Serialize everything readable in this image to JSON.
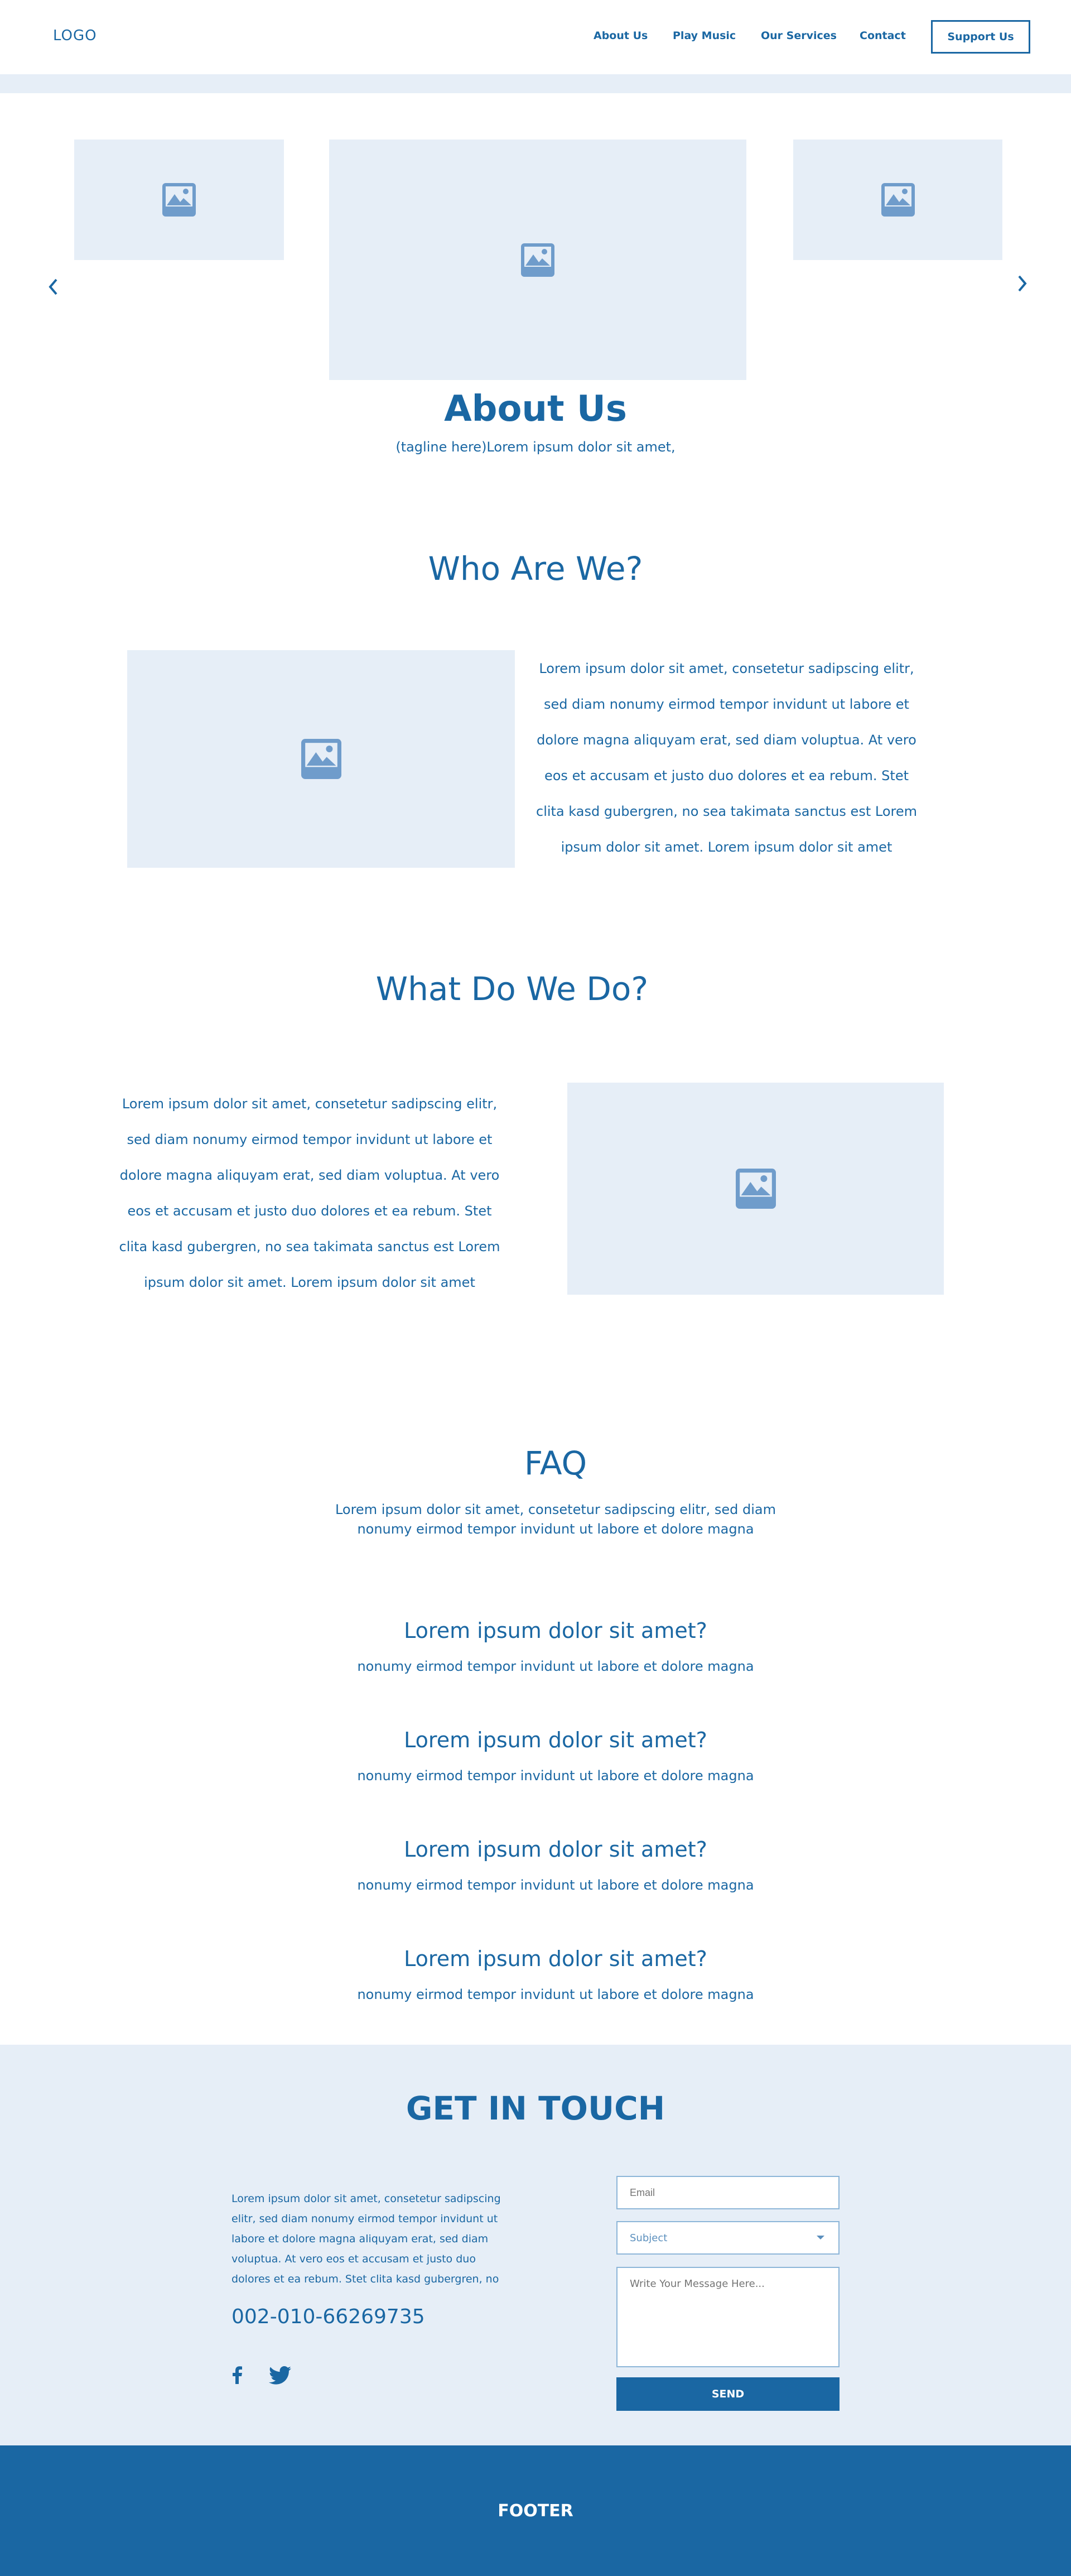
{
  "header": {
    "logo": "LOGO",
    "nav": [
      "About Us",
      "Play Music",
      "Our Services",
      "Contact"
    ],
    "cta": "Support Us"
  },
  "hero": {
    "title": "About Us",
    "tagline": "(tagline here)Lorem ipsum dolor sit amet,"
  },
  "who": {
    "title": "Who Are We?",
    "lines": [
      "Lorem ipsum dolor sit amet, consetetur sadipscing elitr,",
      "sed diam nonumy eirmod tempor invidunt ut labore et",
      "dolore magna aliquyam erat, sed diam voluptua. At vero",
      "eos et accusam et justo duo dolores et ea rebum. Stet",
      "clita kasd gubergren, no sea takimata sanctus est Lorem",
      "ipsum dolor sit amet. Lorem ipsum dolor sit amet"
    ]
  },
  "what": {
    "title": "What Do We Do?",
    "lines": [
      "Lorem ipsum dolor sit amet, consetetur sadipscing elitr,",
      "sed diam nonumy eirmod tempor invidunt ut labore et",
      "dolore magna aliquyam erat, sed diam voluptua. At vero",
      "eos et accusam et justo duo dolores et ea rebum. Stet",
      "clita kasd gubergren, no sea takimata sanctus est Lorem",
      "ipsum dolor sit amet. Lorem ipsum dolor sit amet"
    ]
  },
  "faq": {
    "title": "FAQ",
    "intro": [
      "Lorem ipsum dolor sit amet, consetetur sadipscing elitr, sed diam",
      "nonumy eirmod tempor invidunt ut labore et dolore magna"
    ],
    "items": [
      {
        "q": "Lorem ipsum dolor sit amet?",
        "a": "nonumy eirmod tempor invidunt ut labore et dolore magna"
      },
      {
        "q": "Lorem ipsum dolor sit amet?",
        "a": "nonumy eirmod tempor invidunt ut labore et dolore magna"
      },
      {
        "q": "Lorem ipsum dolor sit amet?",
        "a": "nonumy eirmod tempor invidunt ut labore et dolore magna"
      },
      {
        "q": "Lorem ipsum dolor sit amet?",
        "a": "nonumy eirmod tempor invidunt ut labore et dolore magna"
      }
    ]
  },
  "contact": {
    "title": "GET IN TOUCH",
    "lines": [
      "Lorem ipsum dolor sit amet, consetetur sadipscing",
      "elitr, sed diam nonumy eirmod tempor invidunt ut",
      "labore et dolore magna aliquyam erat, sed diam",
      "voluptua. At vero eos et accusam et justo duo",
      "dolores et ea rebum. Stet clita kasd gubergren, no"
    ],
    "phone": "002-010-66269735",
    "email_placeholder": "Email",
    "subject_placeholder": "Subject",
    "message_placeholder": "Write Your Message Here...",
    "send": "SEND"
  },
  "footer": {
    "label": "FOOTER"
  },
  "colors": {
    "accent": "#1a67a3",
    "placeholder_bg": "#e6eef7",
    "placeholder_icon": "#6f9ccb"
  }
}
